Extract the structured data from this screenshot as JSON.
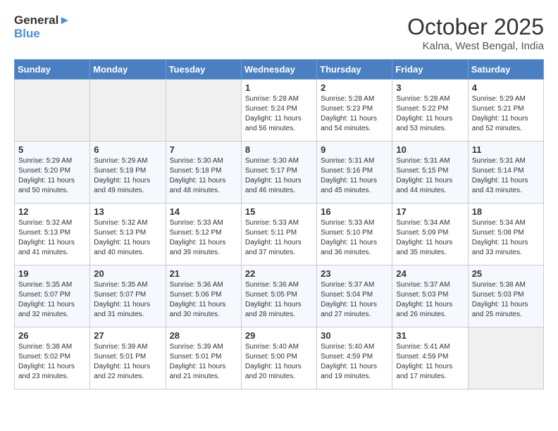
{
  "logo": {
    "line1": "General",
    "line2": "Blue"
  },
  "title": "October 2025",
  "subtitle": "Kalna, West Bengal, India",
  "weekdays": [
    "Sunday",
    "Monday",
    "Tuesday",
    "Wednesday",
    "Thursday",
    "Friday",
    "Saturday"
  ],
  "weeks": [
    [
      {
        "day": "",
        "sunrise": "",
        "sunset": "",
        "daylight": ""
      },
      {
        "day": "",
        "sunrise": "",
        "sunset": "",
        "daylight": ""
      },
      {
        "day": "",
        "sunrise": "",
        "sunset": "",
        "daylight": ""
      },
      {
        "day": "1",
        "sunrise": "Sunrise: 5:28 AM",
        "sunset": "Sunset: 5:24 PM",
        "daylight": "Daylight: 11 hours and 56 minutes."
      },
      {
        "day": "2",
        "sunrise": "Sunrise: 5:28 AM",
        "sunset": "Sunset: 5:23 PM",
        "daylight": "Daylight: 11 hours and 54 minutes."
      },
      {
        "day": "3",
        "sunrise": "Sunrise: 5:28 AM",
        "sunset": "Sunset: 5:22 PM",
        "daylight": "Daylight: 11 hours and 53 minutes."
      },
      {
        "day": "4",
        "sunrise": "Sunrise: 5:29 AM",
        "sunset": "Sunset: 5:21 PM",
        "daylight": "Daylight: 11 hours and 52 minutes."
      }
    ],
    [
      {
        "day": "5",
        "sunrise": "Sunrise: 5:29 AM",
        "sunset": "Sunset: 5:20 PM",
        "daylight": "Daylight: 11 hours and 50 minutes."
      },
      {
        "day": "6",
        "sunrise": "Sunrise: 5:29 AM",
        "sunset": "Sunset: 5:19 PM",
        "daylight": "Daylight: 11 hours and 49 minutes."
      },
      {
        "day": "7",
        "sunrise": "Sunrise: 5:30 AM",
        "sunset": "Sunset: 5:18 PM",
        "daylight": "Daylight: 11 hours and 48 minutes."
      },
      {
        "day": "8",
        "sunrise": "Sunrise: 5:30 AM",
        "sunset": "Sunset: 5:17 PM",
        "daylight": "Daylight: 11 hours and 46 minutes."
      },
      {
        "day": "9",
        "sunrise": "Sunrise: 5:31 AM",
        "sunset": "Sunset: 5:16 PM",
        "daylight": "Daylight: 11 hours and 45 minutes."
      },
      {
        "day": "10",
        "sunrise": "Sunrise: 5:31 AM",
        "sunset": "Sunset: 5:15 PM",
        "daylight": "Daylight: 11 hours and 44 minutes."
      },
      {
        "day": "11",
        "sunrise": "Sunrise: 5:31 AM",
        "sunset": "Sunset: 5:14 PM",
        "daylight": "Daylight: 11 hours and 43 minutes."
      }
    ],
    [
      {
        "day": "12",
        "sunrise": "Sunrise: 5:32 AM",
        "sunset": "Sunset: 5:13 PM",
        "daylight": "Daylight: 11 hours and 41 minutes."
      },
      {
        "day": "13",
        "sunrise": "Sunrise: 5:32 AM",
        "sunset": "Sunset: 5:13 PM",
        "daylight": "Daylight: 11 hours and 40 minutes."
      },
      {
        "day": "14",
        "sunrise": "Sunrise: 5:33 AM",
        "sunset": "Sunset: 5:12 PM",
        "daylight": "Daylight: 11 hours and 39 minutes."
      },
      {
        "day": "15",
        "sunrise": "Sunrise: 5:33 AM",
        "sunset": "Sunset: 5:11 PM",
        "daylight": "Daylight: 11 hours and 37 minutes."
      },
      {
        "day": "16",
        "sunrise": "Sunrise: 5:33 AM",
        "sunset": "Sunset: 5:10 PM",
        "daylight": "Daylight: 11 hours and 36 minutes."
      },
      {
        "day": "17",
        "sunrise": "Sunrise: 5:34 AM",
        "sunset": "Sunset: 5:09 PM",
        "daylight": "Daylight: 11 hours and 35 minutes."
      },
      {
        "day": "18",
        "sunrise": "Sunrise: 5:34 AM",
        "sunset": "Sunset: 5:08 PM",
        "daylight": "Daylight: 11 hours and 33 minutes."
      }
    ],
    [
      {
        "day": "19",
        "sunrise": "Sunrise: 5:35 AM",
        "sunset": "Sunset: 5:07 PM",
        "daylight": "Daylight: 11 hours and 32 minutes."
      },
      {
        "day": "20",
        "sunrise": "Sunrise: 5:35 AM",
        "sunset": "Sunset: 5:07 PM",
        "daylight": "Daylight: 11 hours and 31 minutes."
      },
      {
        "day": "21",
        "sunrise": "Sunrise: 5:36 AM",
        "sunset": "Sunset: 5:06 PM",
        "daylight": "Daylight: 11 hours and 30 minutes."
      },
      {
        "day": "22",
        "sunrise": "Sunrise: 5:36 AM",
        "sunset": "Sunset: 5:05 PM",
        "daylight": "Daylight: 11 hours and 28 minutes."
      },
      {
        "day": "23",
        "sunrise": "Sunrise: 5:37 AM",
        "sunset": "Sunset: 5:04 PM",
        "daylight": "Daylight: 11 hours and 27 minutes."
      },
      {
        "day": "24",
        "sunrise": "Sunrise: 5:37 AM",
        "sunset": "Sunset: 5:03 PM",
        "daylight": "Daylight: 11 hours and 26 minutes."
      },
      {
        "day": "25",
        "sunrise": "Sunrise: 5:38 AM",
        "sunset": "Sunset: 5:03 PM",
        "daylight": "Daylight: 11 hours and 25 minutes."
      }
    ],
    [
      {
        "day": "26",
        "sunrise": "Sunrise: 5:38 AM",
        "sunset": "Sunset: 5:02 PM",
        "daylight": "Daylight: 11 hours and 23 minutes."
      },
      {
        "day": "27",
        "sunrise": "Sunrise: 5:39 AM",
        "sunset": "Sunset: 5:01 PM",
        "daylight": "Daylight: 11 hours and 22 minutes."
      },
      {
        "day": "28",
        "sunrise": "Sunrise: 5:39 AM",
        "sunset": "Sunset: 5:01 PM",
        "daylight": "Daylight: 11 hours and 21 minutes."
      },
      {
        "day": "29",
        "sunrise": "Sunrise: 5:40 AM",
        "sunset": "Sunset: 5:00 PM",
        "daylight": "Daylight: 11 hours and 20 minutes."
      },
      {
        "day": "30",
        "sunrise": "Sunrise: 5:40 AM",
        "sunset": "Sunset: 4:59 PM",
        "daylight": "Daylight: 11 hours and 19 minutes."
      },
      {
        "day": "31",
        "sunrise": "Sunrise: 5:41 AM",
        "sunset": "Sunset: 4:59 PM",
        "daylight": "Daylight: 11 hours and 17 minutes."
      },
      {
        "day": "",
        "sunrise": "",
        "sunset": "",
        "daylight": ""
      }
    ]
  ]
}
